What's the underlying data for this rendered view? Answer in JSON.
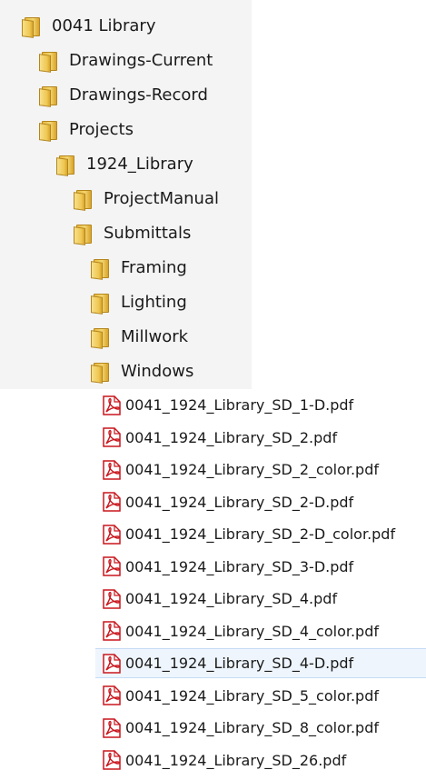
{
  "tree": {
    "items": [
      {
        "label": "0041 Library",
        "level": 0
      },
      {
        "label": "Drawings-Current",
        "level": 1
      },
      {
        "label": "Drawings-Record",
        "level": 1
      },
      {
        "label": "Projects",
        "level": 1
      },
      {
        "label": "1924_Library",
        "level": 2
      },
      {
        "label": "ProjectManual",
        "level": 3
      },
      {
        "label": "Submittals",
        "level": 3
      },
      {
        "label": "Framing",
        "level": 4
      },
      {
        "label": "Lighting",
        "level": 4
      },
      {
        "label": "Millwork",
        "level": 4
      },
      {
        "label": "Windows",
        "level": 4
      }
    ]
  },
  "files": {
    "selected_index": 8,
    "items": [
      {
        "name": "0041_1924_Library_SD_1-D.pdf"
      },
      {
        "name": "0041_1924_Library_SD_2.pdf"
      },
      {
        "name": "0041_1924_Library_SD_2_color.pdf"
      },
      {
        "name": "0041_1924_Library_SD_2-D.pdf"
      },
      {
        "name": "0041_1924_Library_SD_2-D_color.pdf"
      },
      {
        "name": "0041_1924_Library_SD_3-D.pdf"
      },
      {
        "name": "0041_1924_Library_SD_4.pdf"
      },
      {
        "name": "0041_1924_Library_SD_4_color.pdf"
      },
      {
        "name": "0041_1924_Library_SD_4-D.pdf"
      },
      {
        "name": "0041_1924_Library_SD_5_color.pdf"
      },
      {
        "name": "0041_1924_Library_SD_8_color.pdf"
      },
      {
        "name": "0041_1924_Library_SD_26.pdf"
      }
    ]
  },
  "icons": {
    "folder": "folder-icon",
    "pdf": "pdf-file-icon"
  },
  "colors": {
    "folder": "#efc752",
    "pdf_red": "#c8161d",
    "selection": "#eef5fd",
    "selection_border": "#c5dcf4"
  }
}
